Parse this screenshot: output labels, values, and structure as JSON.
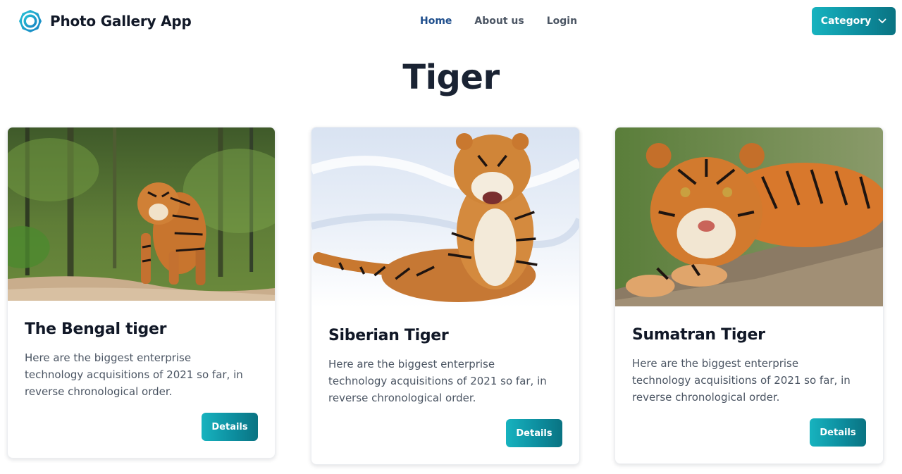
{
  "app": {
    "name": "Photo Gallery App",
    "logo_icon": "gear-aperture-icon",
    "accent_color": "#0d8fa0",
    "nav_active_color": "#1e4e8c"
  },
  "nav": {
    "items": [
      {
        "label": "Home",
        "active": true
      },
      {
        "label": "About us",
        "active": false
      },
      {
        "label": "Login",
        "active": false
      }
    ],
    "category_button": {
      "label": "Category",
      "icon": "chevron-down-icon"
    }
  },
  "page": {
    "title": "Tiger"
  },
  "cards": [
    {
      "image_subject": "bengal-tiger-forest-photo",
      "title": "The Bengal tiger",
      "text": "Here are the biggest enterprise technology acquisitions of 2021 so far, in reverse chronological order.",
      "button_label": "Details"
    },
    {
      "image_subject": "siberian-tiger-snow-photo",
      "title": "Siberian Tiger",
      "text": "Here are the biggest enterprise technology acquisitions of 2021 so far, in reverse chronological order.",
      "button_label": "Details"
    },
    {
      "image_subject": "sumatran-tiger-rock-photo",
      "title": "Sumatran Tiger",
      "text": "Here are the biggest enterprise technology acquisitions of 2021 so far, in reverse chronological order.",
      "button_label": "Details"
    }
  ]
}
